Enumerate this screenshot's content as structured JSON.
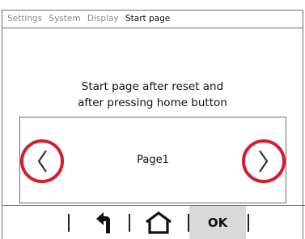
{
  "breadcrumb": {
    "items": [
      "Settings",
      "System",
      "Display"
    ],
    "current": "Start page"
  },
  "prompt": {
    "line1": "Start page after reset and",
    "line2": "after pressing home button"
  },
  "selector": {
    "value": "Page1",
    "prev_icon": "chevron-left-icon",
    "next_icon": "chevron-right-icon",
    "highlight_color": "#d11f2e"
  },
  "bottom_bar": {
    "back_icon": "back-arrow-icon",
    "home_icon": "home-icon",
    "ok_label": "OK",
    "ok_background": "#d9d9d9"
  }
}
